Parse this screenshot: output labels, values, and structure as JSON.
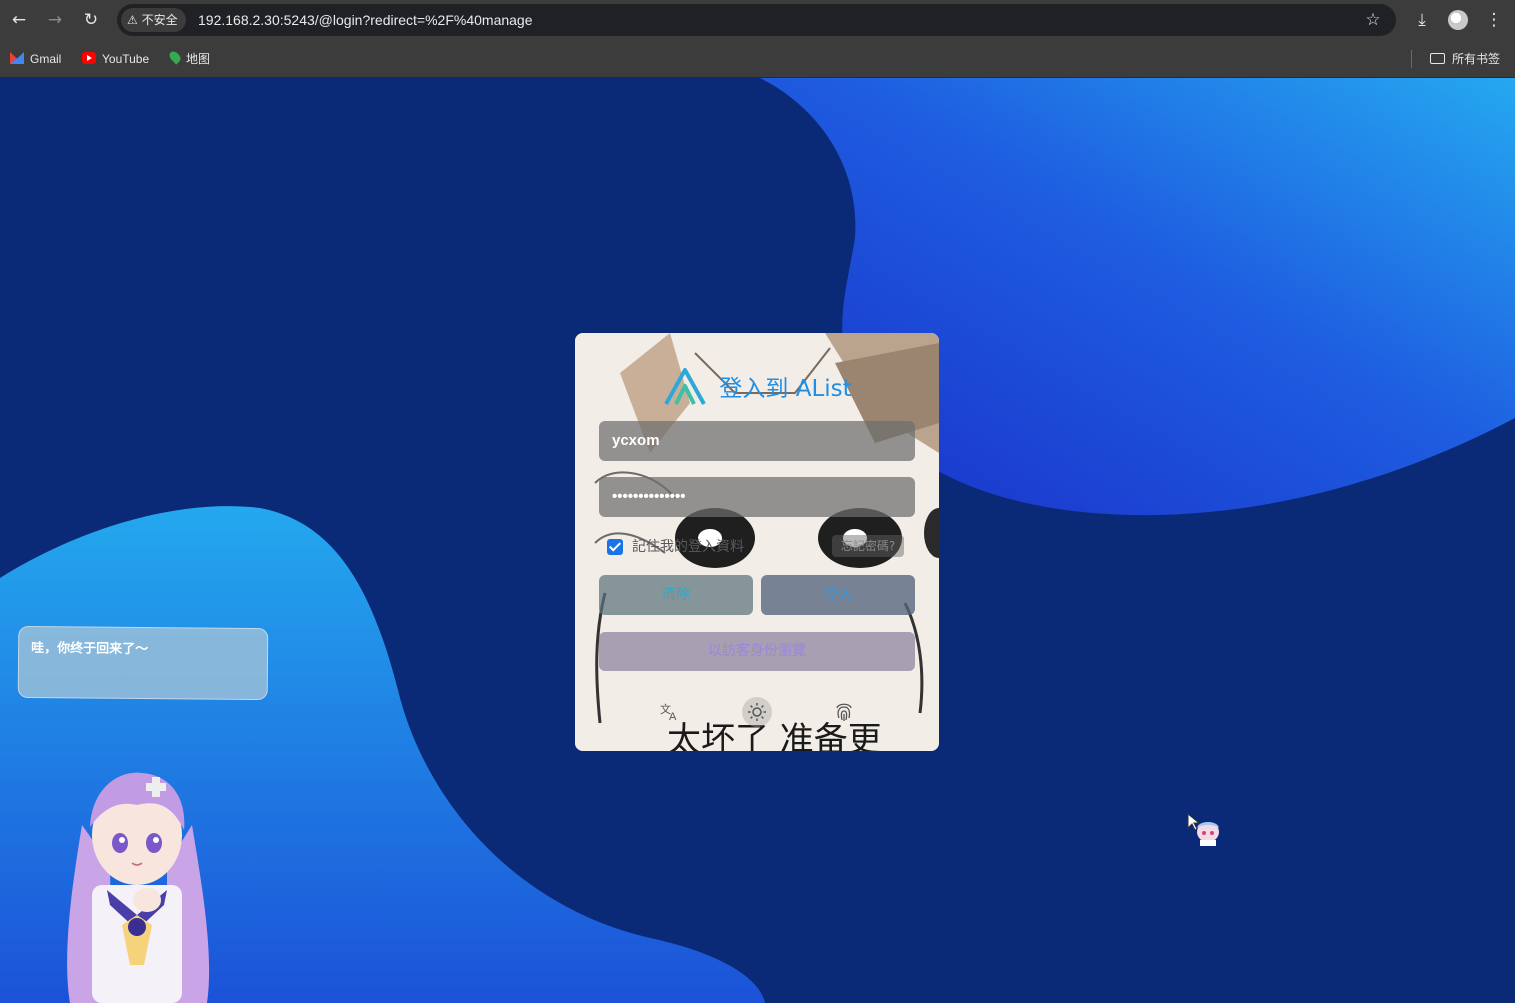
{
  "browser": {
    "security_chip": "不安全",
    "url": "192.168.2.30:5243/@login?redirect=%2F%40manage",
    "bookmarks": [
      {
        "label": "Gmail",
        "icon": "gmail-icon"
      },
      {
        "label": "YouTube",
        "icon": "youtube-icon"
      },
      {
        "label": "地图",
        "icon": "maps-icon"
      }
    ],
    "all_bookmarks": "所有书签"
  },
  "login": {
    "title": "登入到 AList",
    "username_value": "ycxom",
    "password_value": "••••••••••••••",
    "remember_label": "記住我的登入資料",
    "forgot_label": "忘記密碼?",
    "clear_button": "清除",
    "login_button": "登入",
    "guest_button": "以訪客身份瀏覽",
    "footer_icons": [
      "translate-icon",
      "sun-icon",
      "fingerprint-icon"
    ],
    "meme_caption": "太坏了 准备更"
  },
  "mascot": {
    "tip_text": "哇，你终于回来了～"
  },
  "colors": {
    "page_bg": "#0a2a78",
    "accent_blue": "#1e8fe5",
    "checkbox_blue": "#1a73e8"
  }
}
